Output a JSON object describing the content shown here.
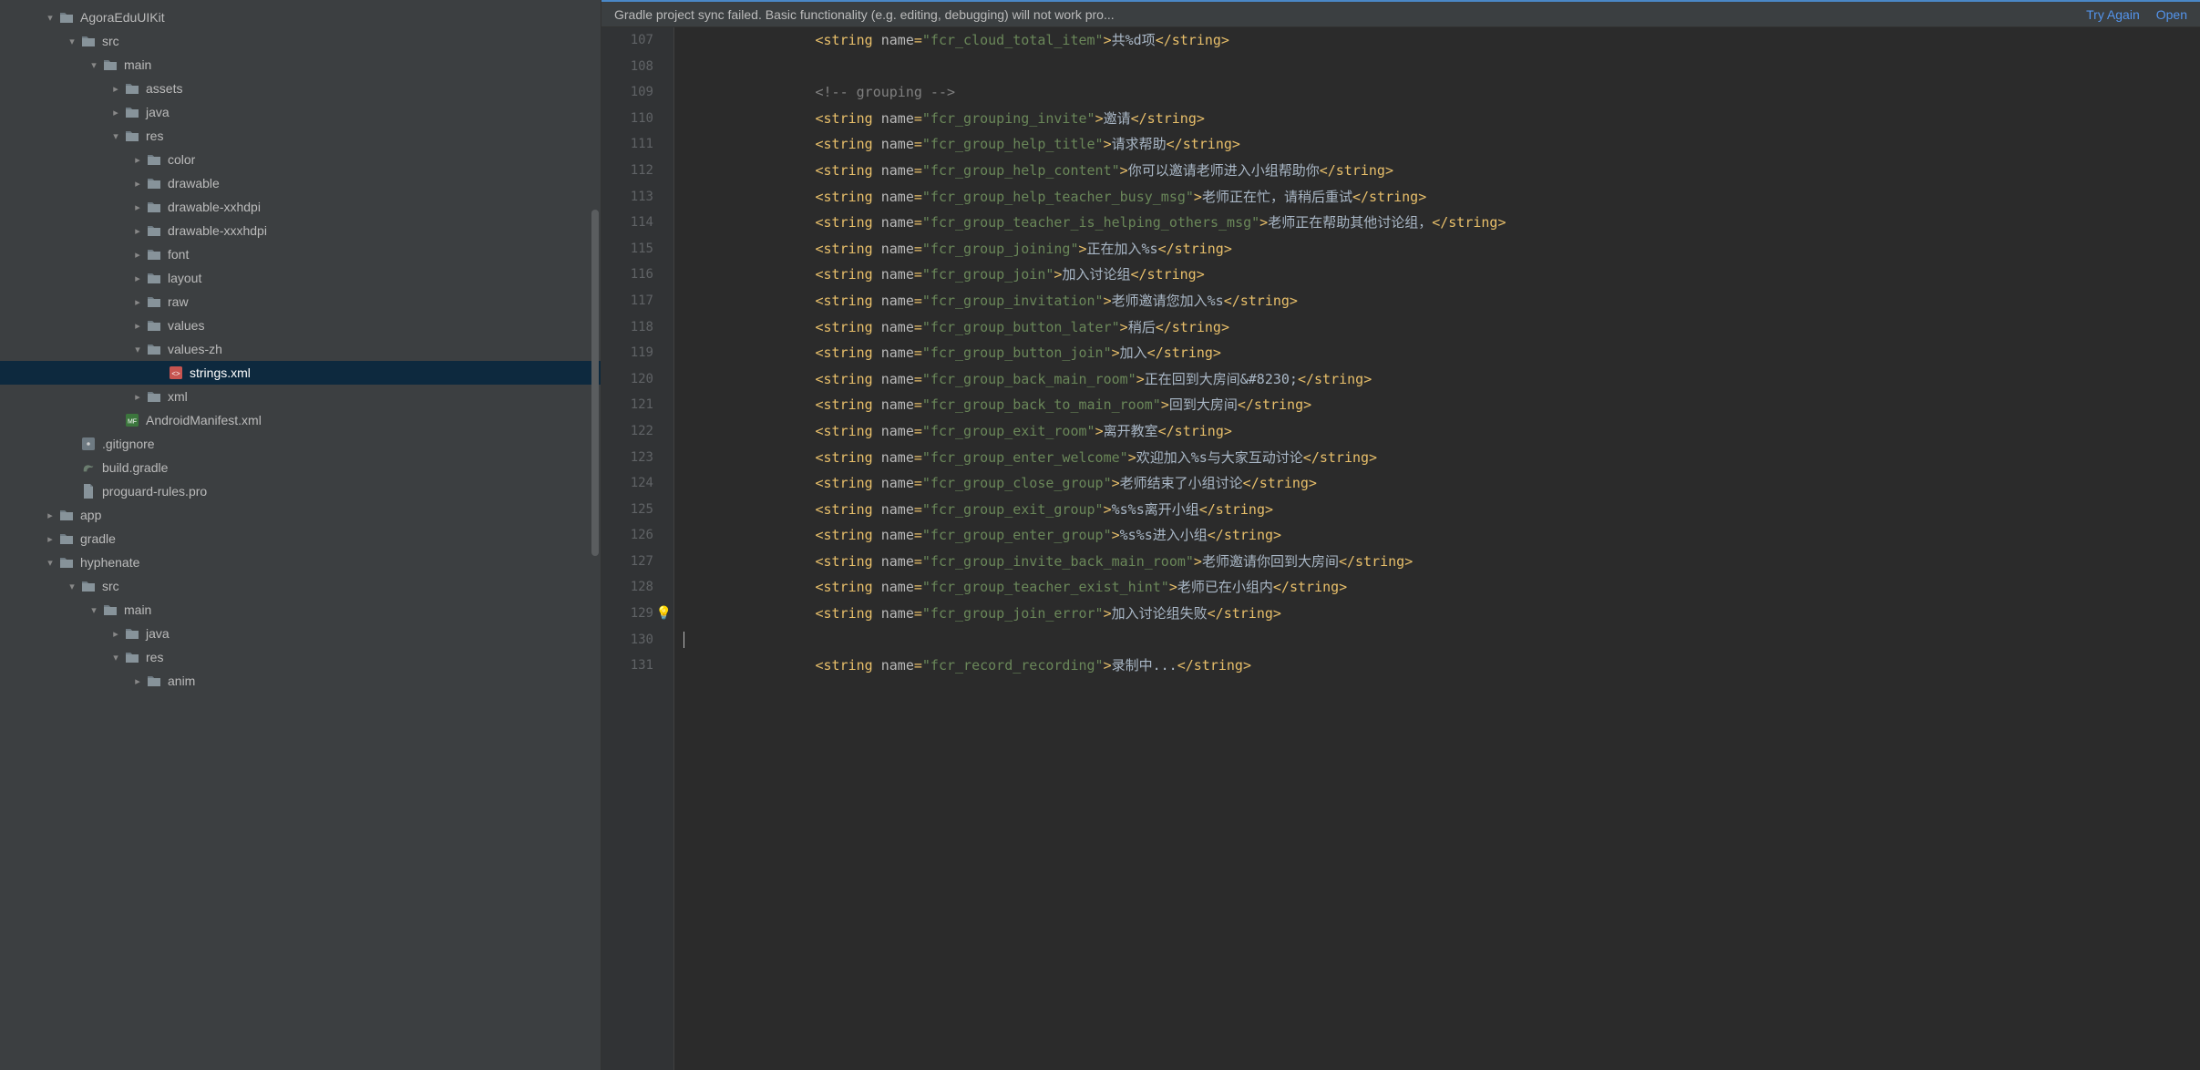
{
  "banner": {
    "message": "Gradle project sync failed. Basic functionality (e.g. editing, debugging) will not work pro...",
    "tryAgain": "Try Again",
    "open": "Open"
  },
  "tree": [
    {
      "d": 0,
      "exp": "down",
      "icon": "folder",
      "label": "AgoraEduUIKit"
    },
    {
      "d": 1,
      "exp": "down",
      "icon": "folder",
      "label": "src"
    },
    {
      "d": 2,
      "exp": "down",
      "icon": "folder",
      "label": "main"
    },
    {
      "d": 3,
      "exp": "right",
      "icon": "folder",
      "label": "assets"
    },
    {
      "d": 3,
      "exp": "right",
      "icon": "folder",
      "label": "java"
    },
    {
      "d": 3,
      "exp": "down",
      "icon": "folder",
      "label": "res"
    },
    {
      "d": 4,
      "exp": "right",
      "icon": "folder",
      "label": "color"
    },
    {
      "d": 4,
      "exp": "right",
      "icon": "folder",
      "label": "drawable"
    },
    {
      "d": 4,
      "exp": "right",
      "icon": "folder",
      "label": "drawable-xxhdpi"
    },
    {
      "d": 4,
      "exp": "right",
      "icon": "folder",
      "label": "drawable-xxxhdpi"
    },
    {
      "d": 4,
      "exp": "right",
      "icon": "folder",
      "label": "font"
    },
    {
      "d": 4,
      "exp": "right",
      "icon": "folder",
      "label": "layout"
    },
    {
      "d": 4,
      "exp": "right",
      "icon": "folder",
      "label": "raw"
    },
    {
      "d": 4,
      "exp": "right",
      "icon": "folder",
      "label": "values"
    },
    {
      "d": 4,
      "exp": "down",
      "icon": "folder",
      "label": "values-zh"
    },
    {
      "d": 5,
      "exp": "none",
      "icon": "xml",
      "label": "strings.xml",
      "selected": true
    },
    {
      "d": 4,
      "exp": "right",
      "icon": "folder",
      "label": "xml"
    },
    {
      "d": 3,
      "exp": "none",
      "icon": "manifest",
      "label": "AndroidManifest.xml"
    },
    {
      "d": 1,
      "exp": "none",
      "icon": "gitignore",
      "label": ".gitignore"
    },
    {
      "d": 1,
      "exp": "none",
      "icon": "gradle",
      "label": "build.gradle"
    },
    {
      "d": 1,
      "exp": "none",
      "icon": "file",
      "label": "proguard-rules.pro"
    },
    {
      "d": 0,
      "exp": "right",
      "icon": "folder",
      "label": "app"
    },
    {
      "d": 0,
      "exp": "right",
      "icon": "folder",
      "label": "gradle"
    },
    {
      "d": 0,
      "exp": "down",
      "icon": "folder",
      "label": "hyphenate"
    },
    {
      "d": 1,
      "exp": "down",
      "icon": "folder",
      "label": "src"
    },
    {
      "d": 2,
      "exp": "down",
      "icon": "folder",
      "label": "main"
    },
    {
      "d": 3,
      "exp": "right",
      "icon": "folder",
      "label": "java"
    },
    {
      "d": 3,
      "exp": "down",
      "icon": "folder",
      "label": "res"
    },
    {
      "d": 4,
      "exp": "right",
      "icon": "folder",
      "label": "anim"
    }
  ],
  "code": {
    "startLine": 107,
    "bulbLine": 129,
    "lines": [
      {
        "indent": 4,
        "tag": "string",
        "attr": "fcr_cloud_total_item",
        "text": "共%d项"
      },
      {
        "blank": true
      },
      {
        "comment": "<!-- grouping -->",
        "indent": 4
      },
      {
        "indent": 4,
        "tag": "string",
        "attr": "fcr_grouping_invite",
        "text": "邀请"
      },
      {
        "indent": 4,
        "tag": "string",
        "attr": "fcr_group_help_title",
        "text": "请求帮助"
      },
      {
        "indent": 4,
        "tag": "string",
        "attr": "fcr_group_help_content",
        "text": "你可以邀请老师进入小组帮助你"
      },
      {
        "indent": 4,
        "tag": "string",
        "attr": "fcr_group_help_teacher_busy_msg",
        "text": "老师正在忙，请稍后重试"
      },
      {
        "indent": 4,
        "tag": "string",
        "attr": "fcr_group_teacher_is_helping_others_msg",
        "text": "老师正在帮助其他讨论组，"
      },
      {
        "indent": 4,
        "tag": "string",
        "attr": "fcr_group_joining",
        "text": "正在加入%s"
      },
      {
        "indent": 4,
        "tag": "string",
        "attr": "fcr_group_join",
        "text": "加入讨论组"
      },
      {
        "indent": 4,
        "tag": "string",
        "attr": "fcr_group_invitation",
        "text": "老师邀请您加入%s"
      },
      {
        "indent": 4,
        "tag": "string",
        "attr": "fcr_group_button_later",
        "text": "稍后"
      },
      {
        "indent": 4,
        "tag": "string",
        "attr": "fcr_group_button_join",
        "text": "加入"
      },
      {
        "indent": 4,
        "tag": "string",
        "attr": "fcr_group_back_main_room",
        "text": "正在回到大房间&#8230;"
      },
      {
        "indent": 4,
        "tag": "string",
        "attr": "fcr_group_back_to_main_room",
        "text": "回到大房间"
      },
      {
        "indent": 4,
        "tag": "string",
        "attr": "fcr_group_exit_room",
        "text": "离开教室"
      },
      {
        "indent": 4,
        "tag": "string",
        "attr": "fcr_group_enter_welcome",
        "text": "欢迎加入%s与大家互动讨论"
      },
      {
        "indent": 4,
        "tag": "string",
        "attr": "fcr_group_close_group",
        "text": "老师结束了小组讨论"
      },
      {
        "indent": 4,
        "tag": "string",
        "attr": "fcr_group_exit_group",
        "text": "%s%s离开小组"
      },
      {
        "indent": 4,
        "tag": "string",
        "attr": "fcr_group_enter_group",
        "text": "%s%s进入小组"
      },
      {
        "indent": 4,
        "tag": "string",
        "attr": "fcr_group_invite_back_main_room",
        "text": "老师邀请你回到大房间"
      },
      {
        "indent": 4,
        "tag": "string",
        "attr": "fcr_group_teacher_exist_hint",
        "text": "老师已在小组内"
      },
      {
        "indent": 4,
        "tag": "string",
        "attr": "fcr_group_join_error",
        "text": "加入讨论组失败"
      },
      {
        "cursor": true
      },
      {
        "indent": 4,
        "tag": "string",
        "attr": "fcr_record_recording",
        "text": "录制中..."
      }
    ]
  }
}
